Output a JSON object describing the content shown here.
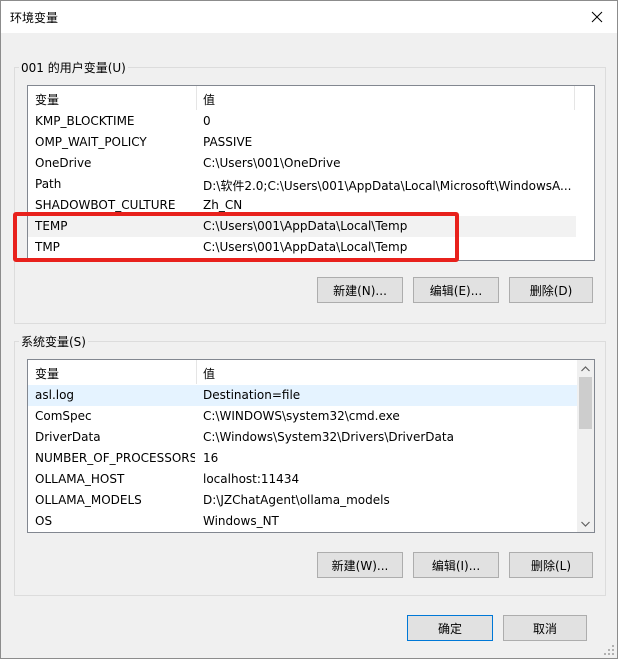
{
  "window": {
    "title": "环境变量"
  },
  "user_vars": {
    "group_label": "001 的用户变量(U)",
    "col_name": "变量",
    "col_value": "值",
    "rows": [
      {
        "name": "KMP_BLOCKTIME",
        "value": "0"
      },
      {
        "name": "OMP_WAIT_POLICY",
        "value": "PASSIVE"
      },
      {
        "name": "OneDrive",
        "value": "C:\\Users\\001\\OneDrive"
      },
      {
        "name": "Path",
        "value": "D:\\软件2.0;C:\\Users\\001\\AppData\\Local\\Microsoft\\WindowsA..."
      },
      {
        "name": "SHADOWBOT_CULTURE",
        "value": "Zh_CN"
      },
      {
        "name": "TEMP",
        "value": "C:\\Users\\001\\AppData\\Local\\Temp"
      },
      {
        "name": "TMP",
        "value": "C:\\Users\\001\\AppData\\Local\\Temp"
      }
    ],
    "new_label": "新建(N)...",
    "edit_label": "编辑(E)...",
    "delete_label": "删除(D)"
  },
  "system_vars": {
    "group_label": "系统变量(S)",
    "col_name": "变量",
    "col_value": "值",
    "rows": [
      {
        "name": "asl.log",
        "value": "Destination=file"
      },
      {
        "name": "ComSpec",
        "value": "C:\\WINDOWS\\system32\\cmd.exe"
      },
      {
        "name": "DriverData",
        "value": "C:\\Windows\\System32\\Drivers\\DriverData"
      },
      {
        "name": "NUMBER_OF_PROCESSORS",
        "value": "16"
      },
      {
        "name": "OLLAMA_HOST",
        "value": "localhost:11434"
      },
      {
        "name": "OLLAMA_MODELS",
        "value": "D:\\JZChatAgent\\ollama_models"
      },
      {
        "name": "OS",
        "value": "Windows_NT"
      }
    ],
    "new_label": "新建(W)...",
    "edit_label": "编辑(I)...",
    "delete_label": "删除(L)"
  },
  "footer": {
    "ok_label": "确定",
    "cancel_label": "取消"
  },
  "colors": {
    "highlight_box": "#e8211c",
    "accent": "#0078d7"
  }
}
